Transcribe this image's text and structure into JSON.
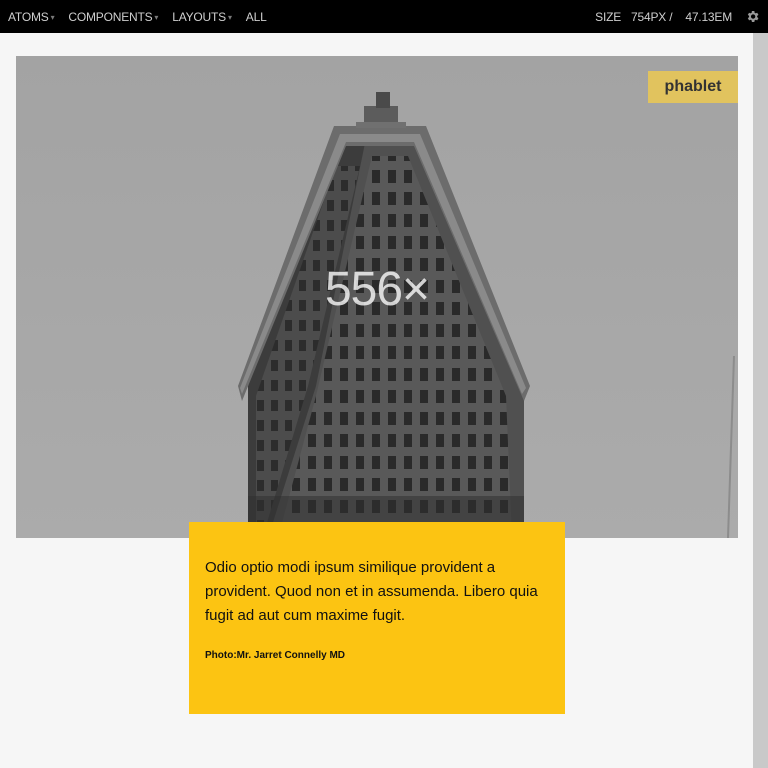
{
  "nav": {
    "items": [
      {
        "label": "ATOMS",
        "has_dropdown": true
      },
      {
        "label": "COMPONENTS",
        "has_dropdown": true
      },
      {
        "label": "LAYOUTS",
        "has_dropdown": true
      },
      {
        "label": "ALL",
        "has_dropdown": false
      }
    ],
    "caret": "▾"
  },
  "size": {
    "label": "SIZE",
    "px_value": "754PX /",
    "em_value": "47.13EM"
  },
  "icons": {
    "settings": "gear-icon"
  },
  "hero": {
    "placeholder_text": "556×",
    "breakpoint_badge": "phablet"
  },
  "caption": {
    "text": "Odio optio modi ipsum similique provident a provident. Quod non et in assumenda. Libero quia fugit ad aut cum maxime fugit.",
    "credit": "Photo:Mr. Jarret Connelly MD"
  },
  "colors": {
    "topbar": "#000000",
    "accent": "#fcc412",
    "badge": "#e1c35e",
    "page_bg": "#f6f6f6"
  }
}
